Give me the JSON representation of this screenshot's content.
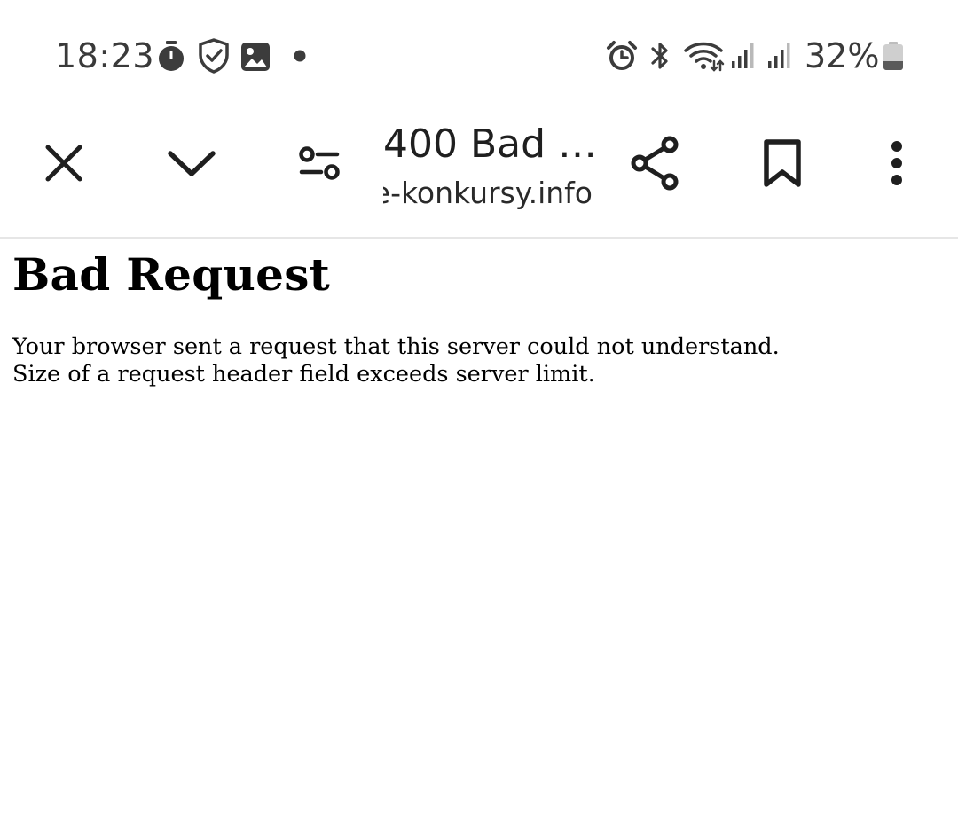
{
  "status_bar": {
    "time": "18:23",
    "battery_percent": "32%",
    "left_icons": [
      "stopwatch-icon",
      "shield-check-icon",
      "gallery-icon",
      "notification-dot-icon"
    ],
    "right_icons": [
      "alarm-icon",
      "bluetooth-icon",
      "wifi-icon",
      "signal-icon",
      "signal-icon",
      "battery-icon"
    ],
    "battery_level": 0.32
  },
  "toolbar": {
    "tab_title": "400 Bad …",
    "tab_url": "e-konkursy.info",
    "icons": [
      "close-icon",
      "chevron-down-icon",
      "tune-icon",
      "share-icon",
      "bookmark-icon",
      "more-vert-icon"
    ]
  },
  "page": {
    "heading": "Bad Request",
    "message_line1": "Your browser sent a request that this server could not understand.",
    "message_line2": "Size of a request header field exceeds server limit."
  },
  "colors": {
    "background": "#ffffff",
    "status_icons": "#3c3c3c",
    "toolbar_icons": "#1f1f1f",
    "divider": "#e6e6e6"
  }
}
